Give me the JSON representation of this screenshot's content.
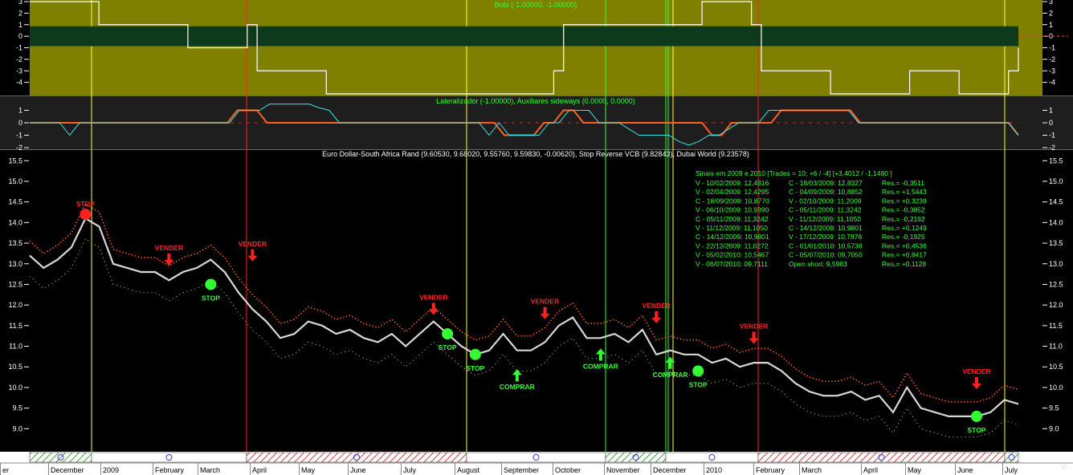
{
  "colors": {
    "panel_olive": "#808000",
    "panel_gray": "#202020",
    "price_bg": "#000000",
    "accent_green": "#33ff33",
    "sell_red": "#ff2020",
    "stop_orange": "#ff6020",
    "buy_green": "#33ff33",
    "vline_yellow": "#ffff40",
    "vline_red": "#ff2020",
    "vline_green": "#33ff33"
  },
  "chart_data": [
    {
      "type": "line",
      "pane": "bobi",
      "title": "Bobi (-1.00000, -1.00000)",
      "ylim": [
        -5,
        3
      ],
      "yticks": [
        3,
        2,
        1,
        0,
        -1,
        -2,
        -3,
        -4
      ],
      "series": [
        {
          "values": [
            3,
            3,
            3,
            3,
            3,
            3,
            3,
            1,
            1,
            1,
            1,
            1,
            1,
            1,
            1,
            1,
            -1,
            -1,
            -1,
            -1,
            -1,
            -1,
            1,
            -3,
            -3,
            -3,
            -3,
            -3,
            -3,
            -3,
            -5,
            -5,
            -5,
            -5,
            -5,
            -5,
            -5,
            -5,
            -5,
            -5,
            -5,
            -5,
            -5,
            -5,
            -5,
            -5,
            -5,
            -5,
            -5,
            -5,
            -5,
            -5,
            -5,
            -3,
            1,
            1,
            1,
            1,
            1,
            1,
            1,
            1,
            1,
            1,
            1,
            1,
            1,
            1,
            3,
            3,
            3,
            3,
            3,
            1,
            -3,
            -3,
            -3,
            -3,
            -3,
            -3,
            -3,
            -5,
            -5,
            -5,
            -5,
            -5,
            -5,
            -5,
            -5,
            -3,
            -3,
            -3,
            -3,
            -3,
            -5,
            -5,
            -5,
            -5,
            -5,
            -3,
            -1
          ]
        }
      ]
    },
    {
      "type": "line",
      "pane": "lateralizador",
      "title": "Lateralizador (-1.00000), Auxiliares sideways (0.0000, 0.0000)",
      "ylim": [
        -2,
        2
      ],
      "yticks": [
        1,
        0,
        -1,
        -2
      ],
      "series": [
        {
          "values": [
            0,
            0,
            0,
            0,
            0,
            0,
            0,
            0,
            0,
            0,
            0,
            0,
            0,
            0,
            0,
            0,
            0,
            0,
            0,
            0,
            0,
            1,
            1,
            1,
            0,
            0,
            0,
            0,
            0,
            0,
            0,
            0,
            0,
            0,
            0,
            0,
            0,
            0,
            0,
            0,
            0,
            0,
            0,
            0,
            0,
            0,
            0,
            0,
            -1,
            -1,
            -1,
            -1,
            0,
            0,
            1,
            1,
            0,
            0,
            0,
            0,
            0,
            0,
            0,
            0,
            0,
            0,
            0,
            0,
            0,
            -1,
            -1,
            0,
            0,
            0,
            0,
            0,
            1,
            1,
            1,
            1,
            1,
            1,
            1,
            1,
            0,
            0,
            0,
            0,
            0,
            0,
            0,
            0,
            0,
            0,
            0,
            0,
            0,
            0,
            0,
            0,
            -1
          ]
        },
        {
          "values": [
            0,
            0,
            0,
            0,
            -1,
            0,
            0,
            0,
            0,
            0,
            0,
            0,
            0,
            0,
            0,
            0,
            0,
            0,
            0,
            0,
            0,
            1,
            1,
            1,
            1.5,
            1.5,
            1.5,
            1.5,
            1.5,
            1.2,
            1,
            0,
            0,
            0,
            0,
            0,
            0,
            0,
            0,
            0,
            0,
            0,
            0,
            0,
            0,
            0,
            -1,
            0,
            -1,
            -1,
            -1,
            -1,
            0,
            0,
            1,
            1,
            1,
            0,
            0,
            0,
            -0.5,
            -1,
            -1,
            -1,
            -1,
            -1.5,
            -1.8,
            -1.5,
            -1,
            -1,
            -0.5,
            0,
            0,
            0,
            1,
            1,
            1,
            1,
            1,
            1,
            1,
            1,
            1,
            0,
            0,
            0,
            0,
            0,
            0,
            0,
            0,
            0,
            0,
            0,
            0,
            0,
            0,
            0,
            0,
            -1
          ]
        }
      ]
    },
    {
      "type": "line",
      "pane": "price",
      "title": "Euro Dollar-South Africa Rand (9.60530, 9.68020, 9.55760, 9.59830, -0.00620), Stop Reverse VCB (9.82843), Dubai World (9.23578)",
      "ylim": [
        8.5,
        15.7
      ],
      "yticks": [
        15.5,
        15.0,
        14.5,
        14.0,
        13.5,
        13.0,
        12.5,
        12.0,
        11.5,
        11.0,
        10.5,
        10.0,
        9.5,
        9.0
      ],
      "x": [
        "December",
        "2009",
        "February",
        "March",
        "April",
        "May",
        "June",
        "July",
        "August",
        "September",
        "October",
        "November",
        "December",
        "2010",
        "February",
        "March",
        "April",
        "May",
        "June",
        "July"
      ],
      "series": [
        {
          "values": [
            13.2,
            12.9,
            13.1,
            13.4,
            14.1,
            13.9,
            13.0,
            12.9,
            12.8,
            12.8,
            12.6,
            12.8,
            12.9,
            13.1,
            12.8,
            12.3,
            11.9,
            11.6,
            11.2,
            11.3,
            11.6,
            11.5,
            11.3,
            11.4,
            11.2,
            11.1,
            11.3,
            11.0,
            11.3,
            11.6,
            11.3,
            11.0,
            10.8,
            10.9,
            11.3,
            10.9,
            10.9,
            11.1,
            11.5,
            11.7,
            11.2,
            11.2,
            11.3,
            11.1,
            11.4,
            10.8,
            10.9,
            10.8,
            10.8,
            10.6,
            10.7,
            10.5,
            10.6,
            10.6,
            10.4,
            10.1,
            9.9,
            9.8,
            9.8,
            9.9,
            9.7,
            9.8,
            9.4,
            10.0,
            9.5,
            9.4,
            9.3,
            9.3,
            9.3,
            9.4,
            9.7,
            9.6
          ]
        }
      ],
      "signals": [
        {
          "label": "STOP",
          "kind": "sell-stop",
          "x_index": 4,
          "y": 14.2
        },
        {
          "label": "VENDER",
          "kind": "sell",
          "x_index": 10,
          "y": 12.9
        },
        {
          "label": "STOP",
          "kind": "buy-stop",
          "x_index": 13,
          "y": 12.5
        },
        {
          "label": "VENDER",
          "kind": "sell",
          "x_index": 16,
          "y": 13.0
        },
        {
          "label": "VENDER",
          "kind": "sell",
          "x_index": 29,
          "y": 11.7
        },
        {
          "label": "STOP",
          "kind": "buy-stop",
          "x_index": 30,
          "y": 11.3
        },
        {
          "label": "STOP",
          "kind": "buy-stop",
          "x_index": 32,
          "y": 10.8
        },
        {
          "label": "COMPRAR",
          "kind": "buy",
          "x_index": 35,
          "y": 10.5
        },
        {
          "label": "VENDER",
          "kind": "sell",
          "x_index": 37,
          "y": 11.6
        },
        {
          "label": "COMPRAR",
          "kind": "buy",
          "x_index": 41,
          "y": 11.0
        },
        {
          "label": "VENDER",
          "kind": "sell",
          "x_index": 45,
          "y": 11.5
        },
        {
          "label": "COMPRAR",
          "kind": "buy",
          "x_index": 46,
          "y": 10.8
        },
        {
          "label": "STOP",
          "kind": "buy-stop",
          "x_index": 48,
          "y": 10.4
        },
        {
          "label": "VENDER",
          "kind": "sell",
          "x_index": 52,
          "y": 11.0
        },
        {
          "label": "VENDER",
          "kind": "sell",
          "x_index": 68,
          "y": 9.9
        },
        {
          "label": "STOP",
          "kind": "buy-stop",
          "x_index": 68,
          "y": 9.3
        }
      ]
    }
  ],
  "stats": {
    "header": "Sinais em 2009 e 2010 [Trades = 10; +6 / -4] [+3,4012 / -1,1480 ]",
    "rows": [
      [
        "V - 10/02/2009: 12,4816",
        "C - 18/03/2009: 12,8327",
        "Res.= -0,3511"
      ],
      [
        "V - 02/04/2009: 12,4295",
        "C - 04/09/2009: 10,8852",
        "Res.= +1,5443"
      ],
      [
        "C - 18/09/2009: 10,8770",
        "V - 02/10/2009: 11,2009",
        "Res.= +0,3239"
      ],
      [
        "V - 06/10/2009: 10,9390",
        "C - 05/11/2009: 11,3242",
        "Res.= -0,3852"
      ],
      [
        "C - 05/11/2009: 11,3242",
        "V - 11/12/2009: 11,1050",
        "Res.= -0,2192"
      ],
      [
        "V - 11/12/2009: 11,1050",
        "C - 14/12/2009: 10,9801",
        "Res.= +0,1249"
      ],
      [
        "C - 14/12/2009: 10,9801",
        "V - 17/12/2009: 10,7876",
        "Res.= -0,1925"
      ],
      [
        "V - 22/12/2009: 11,0272",
        "C - 01/01/2010: 10,5736",
        "Res.= +0,4536"
      ],
      [
        "V - 05/02/2010: 10,5467",
        "C - 05/07/2010: 09,7050",
        "Res.= +0,8417"
      ],
      [
        "V - 06/07/2010: 09,7111",
        "Open short: 9,5983",
        "Res.= +0,1128"
      ]
    ]
  },
  "timeline_months": [
    "er",
    "December",
    "2009",
    "February",
    "March",
    "April",
    "May",
    "June",
    "July",
    "August",
    "September",
    "October",
    "November",
    "December",
    "2010",
    "February",
    "March",
    "April",
    "May",
    "June",
    "July"
  ],
  "copyright": "©"
}
